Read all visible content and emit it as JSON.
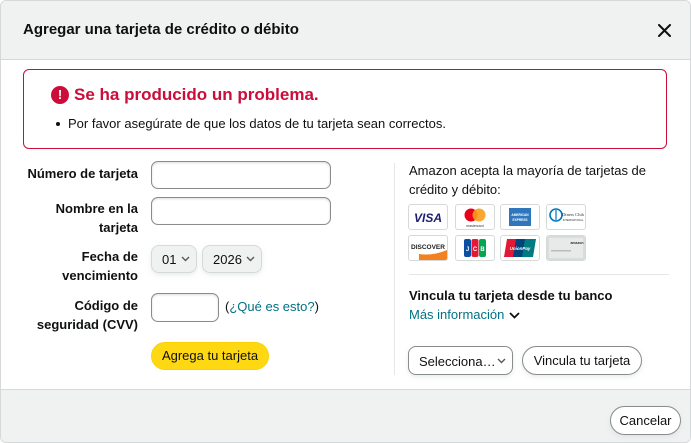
{
  "dialog": {
    "title": "Agregar una tarjeta de crédito o débito"
  },
  "alert": {
    "icon": "exclamation-circle-icon",
    "title": "Se ha producido un problema.",
    "items": [
      "Por favor asegúrate de que los datos de tu tarjeta sean correctos."
    ],
    "color": "#cc0c39"
  },
  "form": {
    "card_number": {
      "label": "Número de tarjeta",
      "value": ""
    },
    "card_name": {
      "label_line1": "Nombre en la",
      "label_line2": "tarjeta",
      "value": ""
    },
    "expiry": {
      "label_line1": "Fecha de",
      "label_line2": "vencimiento",
      "month": "01",
      "year": "2026"
    },
    "cvv": {
      "label_line1": "Código de",
      "label_line2": "seguridad (CVV)",
      "value": "",
      "help_open": "(",
      "help_link": "¿Qué es esto?",
      "help_close": ")"
    },
    "submit_label": "Agrega tu tarjeta",
    "submit_color": "#ffd814"
  },
  "side": {
    "accepts_text": "Amazon acepta la mayoría de tarjetas de crédito y débito:",
    "cards": [
      {
        "name": "VISA"
      },
      {
        "name": "mastercard"
      },
      {
        "name": "AMERICAN EXPRESS"
      },
      {
        "name": "Diners Club International"
      },
      {
        "name": "DISCOVER"
      },
      {
        "name": "JCB"
      },
      {
        "name": "UnionPay"
      },
      {
        "name": "amazon"
      }
    ],
    "bank_title": "Vincula tu tarjeta desde tu banco",
    "more_info_link": "Más información",
    "bank_select": "Selecciona…",
    "bank_button": "Vincula tu tarjeta"
  },
  "footer": {
    "cancel_label": "Cancelar"
  },
  "colors": {
    "link": "#007185",
    "header_bg": "#f0f2f2"
  }
}
